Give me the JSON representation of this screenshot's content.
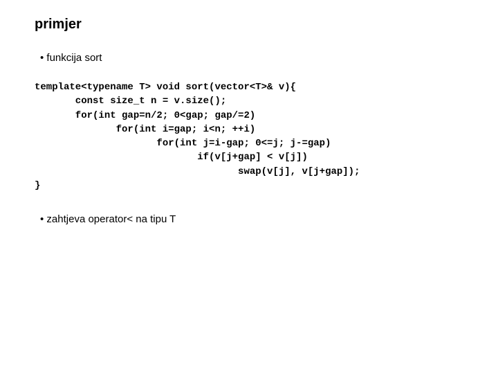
{
  "title": "primjer",
  "bullet1": "• funkcija sort",
  "code": "template<typename T> void sort(vector<T>& v){\n       const size_t n = v.size();\n       for(int gap=n/2; 0<gap; gap/=2)\n              for(int i=gap; i<n; ++i)\n                     for(int j=i-gap; 0<=j; j-=gap)\n                            if(v[j+gap] < v[j])\n                                   swap(v[j], v[j+gap]);\n}",
  "bullet2": "• zahtjeva operator< na tipu T"
}
